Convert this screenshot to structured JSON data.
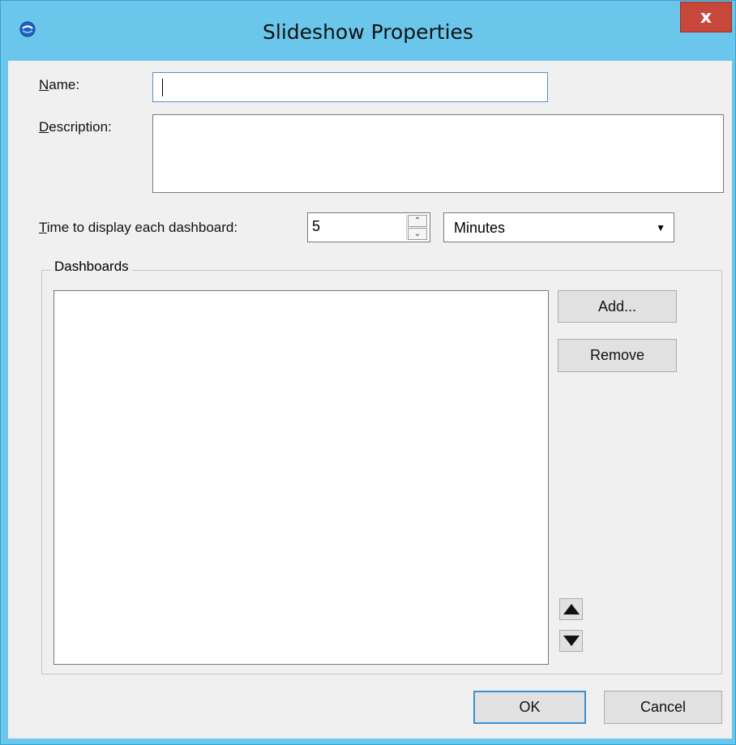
{
  "window": {
    "title": "Slideshow Properties",
    "close_label": "x",
    "colors": {
      "titlebar": "#6bc6eb",
      "close": "#c7483b",
      "client": "#f0f0f0"
    }
  },
  "form": {
    "name_label_key": "N",
    "name_label_rest": "ame:",
    "name_value": "",
    "description_label_key": "D",
    "description_label_rest": "escription:",
    "description_value": "",
    "time_label_key": "T",
    "time_label_rest": "ime to display each dashboard:",
    "time_value": "5",
    "time_unit": "Minutes"
  },
  "dashboards": {
    "group_title": "Dashboards",
    "items": [],
    "add_label": "Add...",
    "remove_label": "Remove"
  },
  "footer": {
    "ok_label": "OK",
    "cancel_label": "Cancel"
  }
}
